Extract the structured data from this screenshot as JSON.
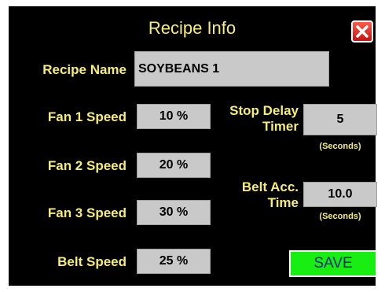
{
  "window": {
    "title": "Recipe Info",
    "close_icon": "close-icon"
  },
  "recipe_name": {
    "label": "Recipe Name",
    "value": "SOYBEANS 1"
  },
  "fan1": {
    "label": "Fan 1 Speed",
    "value": "10 %"
  },
  "fan2": {
    "label": "Fan 2 Speed",
    "value": "20 %"
  },
  "fan3": {
    "label": "Fan 3 Speed",
    "value": "30 %"
  },
  "belt_speed": {
    "label": "Belt Speed",
    "value": "25 %"
  },
  "stop_delay": {
    "label_line1": "Stop Delay",
    "label_line2": "Timer",
    "value": "5",
    "unit": "(Seconds)"
  },
  "belt_acc": {
    "label_line1": "Belt Acc.",
    "label_line2": "Time",
    "value": "10.0",
    "unit": "(Seconds)"
  },
  "save_button": {
    "label": "SAVE"
  },
  "colors": {
    "background": "#000000",
    "label": "#f5ec7a",
    "field": "#c9c9c9",
    "save": "#19ee12",
    "save_text": "#0b2a8c",
    "close": "#e02020"
  }
}
